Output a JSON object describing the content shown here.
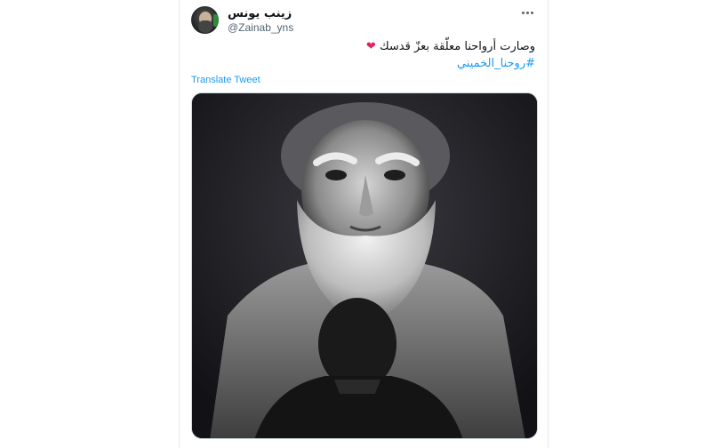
{
  "tweet": {
    "display_name": "زينب يونس",
    "handle": "@Zainab_yns",
    "text": "وصارت أرواحنا معلّقة بعزّ قدسك",
    "heart_glyph": "❤",
    "hashtag": "#روحنا_الخميني",
    "translate_label": "Translate Tweet",
    "more_icon": "more-horizontal-icon"
  },
  "colors": {
    "link": "#1d9bf0",
    "text": "#0f1419",
    "secondary": "#536471",
    "heart": "#e0245e"
  }
}
